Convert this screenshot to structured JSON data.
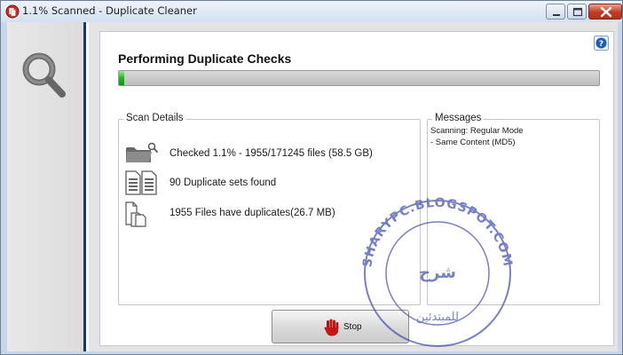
{
  "window": {
    "title": "1.1% Scanned - Duplicate Cleaner"
  },
  "icons": {
    "app": "duplicate-cleaner-app-icon",
    "sidebar": "magnifier-icon",
    "help": "help-icon",
    "checked": "folder-search-icon",
    "duplicates": "duplicate-documents-icon",
    "files": "files-icon",
    "stop": "stop-hand-icon"
  },
  "main": {
    "heading": "Performing Duplicate Checks",
    "progress_percent": 1.1
  },
  "scan_details": {
    "legend": "Scan Details",
    "rows": [
      {
        "text": "Checked 1.1% - 1955/171245 files (58.5 GB)"
      },
      {
        "text": "90 Duplicate sets found"
      },
      {
        "text": "1955 Files have duplicates(26.7 MB)"
      }
    ]
  },
  "messages": {
    "legend": "Messages",
    "lines": [
      "Scanning: Regular Mode",
      "- Same Content (MD5)"
    ]
  },
  "stop_button": {
    "label": "Stop"
  },
  "watermark": {
    "text": "SHARYPC.BLOGSPOT.COM",
    "arabic": "شرح للمبتدئين"
  },
  "colors": {
    "progress_fill": "#21b521",
    "sidebar_accent": "#163a66",
    "close_button": "#c23b22",
    "watermark": "#4a55b5"
  }
}
